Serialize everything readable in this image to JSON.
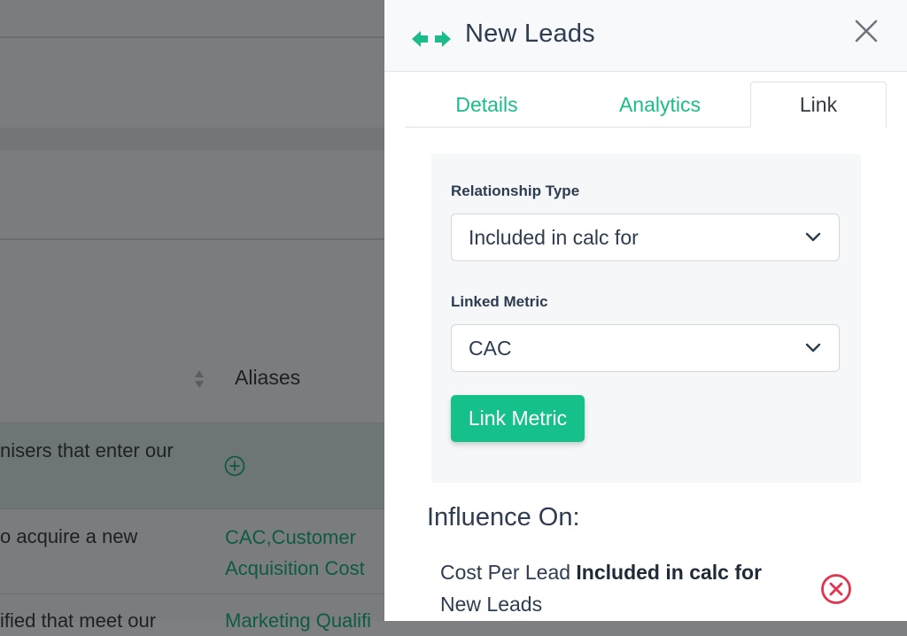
{
  "background": {
    "column_header": "Aliases",
    "rows": [
      {
        "description": "nisers that enter our",
        "aliases": []
      },
      {
        "description": "o acquire a new",
        "aliases": [
          "CAC,Customer",
          "Acquisition Cost"
        ]
      },
      {
        "description": "ified that meet our",
        "aliases": [
          "Marketing Qualifi"
        ]
      }
    ]
  },
  "drawer": {
    "title": "New Leads",
    "tabs": [
      {
        "label": "Details"
      },
      {
        "label": "Analytics"
      },
      {
        "label": "Link"
      }
    ],
    "active_tab": "Link",
    "relationship_type": {
      "label": "Relationship Type",
      "value": "Included in calc for"
    },
    "linked_metric": {
      "label": "Linked Metric",
      "value": "CAC"
    },
    "link_button": "Link Metric",
    "influence": {
      "title": "Influence On:",
      "source": "Cost Per Lead",
      "relation": "Included in calc for",
      "target": "New Leads"
    }
  },
  "colors": {
    "accent": "#1cbb8c",
    "button": "#16c08a",
    "danger": "#e0344f",
    "text": "#2d3c50"
  }
}
